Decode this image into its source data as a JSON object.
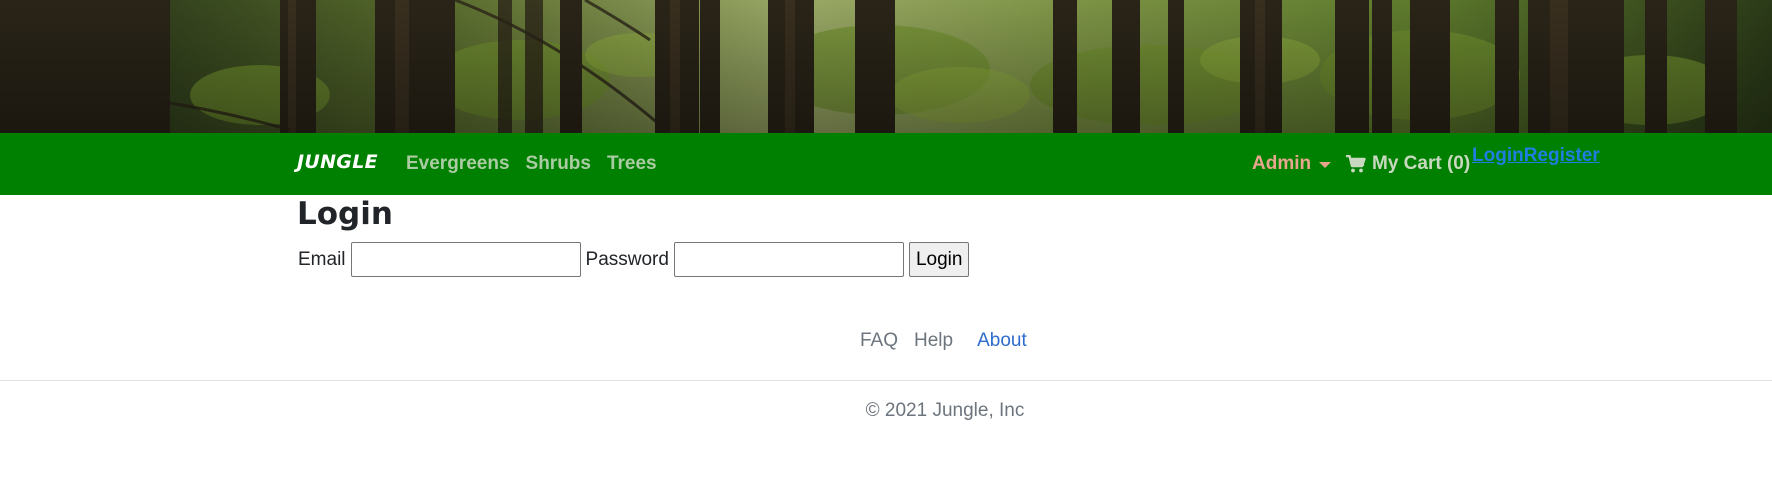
{
  "hero": {
    "image": "forest-banner"
  },
  "navbar": {
    "brand": "JUNGLE",
    "links": [
      {
        "label": "Evergreens"
      },
      {
        "label": "Shrubs"
      },
      {
        "label": "Trees"
      }
    ],
    "admin_label": "Admin",
    "cart_label": "My Cart (0)",
    "cart_icon": "shopping-cart-icon",
    "login_label": "Login",
    "register_label": "Register",
    "colors": {
      "background": "#008000",
      "admin": "#e7a68e",
      "auth_link": "#1e7fe0"
    }
  },
  "main": {
    "title": "Login",
    "email_label": "Email",
    "email_value": "",
    "password_label": "Password",
    "password_value": "",
    "submit_label": "Login"
  },
  "footer": {
    "links": [
      {
        "label": "FAQ"
      },
      {
        "label": "Help"
      },
      {
        "label": "About"
      }
    ],
    "copyright": "© 2021 Jungle, Inc"
  }
}
